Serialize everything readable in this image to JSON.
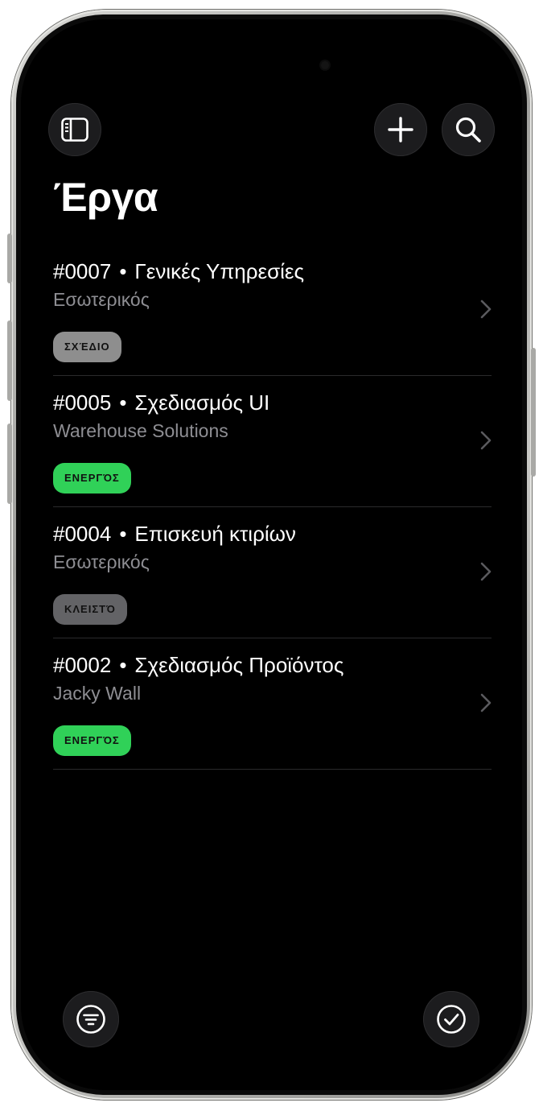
{
  "header": {
    "title": "Έργα",
    "sidebar_icon": "sidebar-icon",
    "add_icon": "plus-icon",
    "search_icon": "search-icon"
  },
  "projects": [
    {
      "number": "#0007",
      "name": "Γενικές Υπηρεσίες",
      "client": "Εσωτερικός",
      "status": "ΣΧΈΔΙΟ",
      "status_color": "#8e8e8e"
    },
    {
      "number": "#0005",
      "name": "Σχεδιασμός UI",
      "client": "Warehouse Solutions",
      "status": "ΕΝΕΡΓΌΣ",
      "status_color": "#30d158"
    },
    {
      "number": "#0004",
      "name": "Επισκευή κτιρίων",
      "client": "Εσωτερικός",
      "status": "ΚΛΕΙΣΤΌ",
      "status_color": "#636366"
    },
    {
      "number": "#0002",
      "name": "Σχεδιασμός Προϊόντος",
      "client": "Jacky Wall",
      "status": "ΕΝΕΡΓΌΣ",
      "status_color": "#30d158"
    }
  ],
  "separator": "•",
  "footer": {
    "filter_icon": "filter-icon",
    "done_icon": "checkmark-circle-icon"
  },
  "colors": {
    "background": "#000000",
    "text_primary": "#ffffff",
    "text_secondary": "#8e8e93",
    "active": "#30d158",
    "draft": "#8e8e8e",
    "closed": "#636366"
  }
}
